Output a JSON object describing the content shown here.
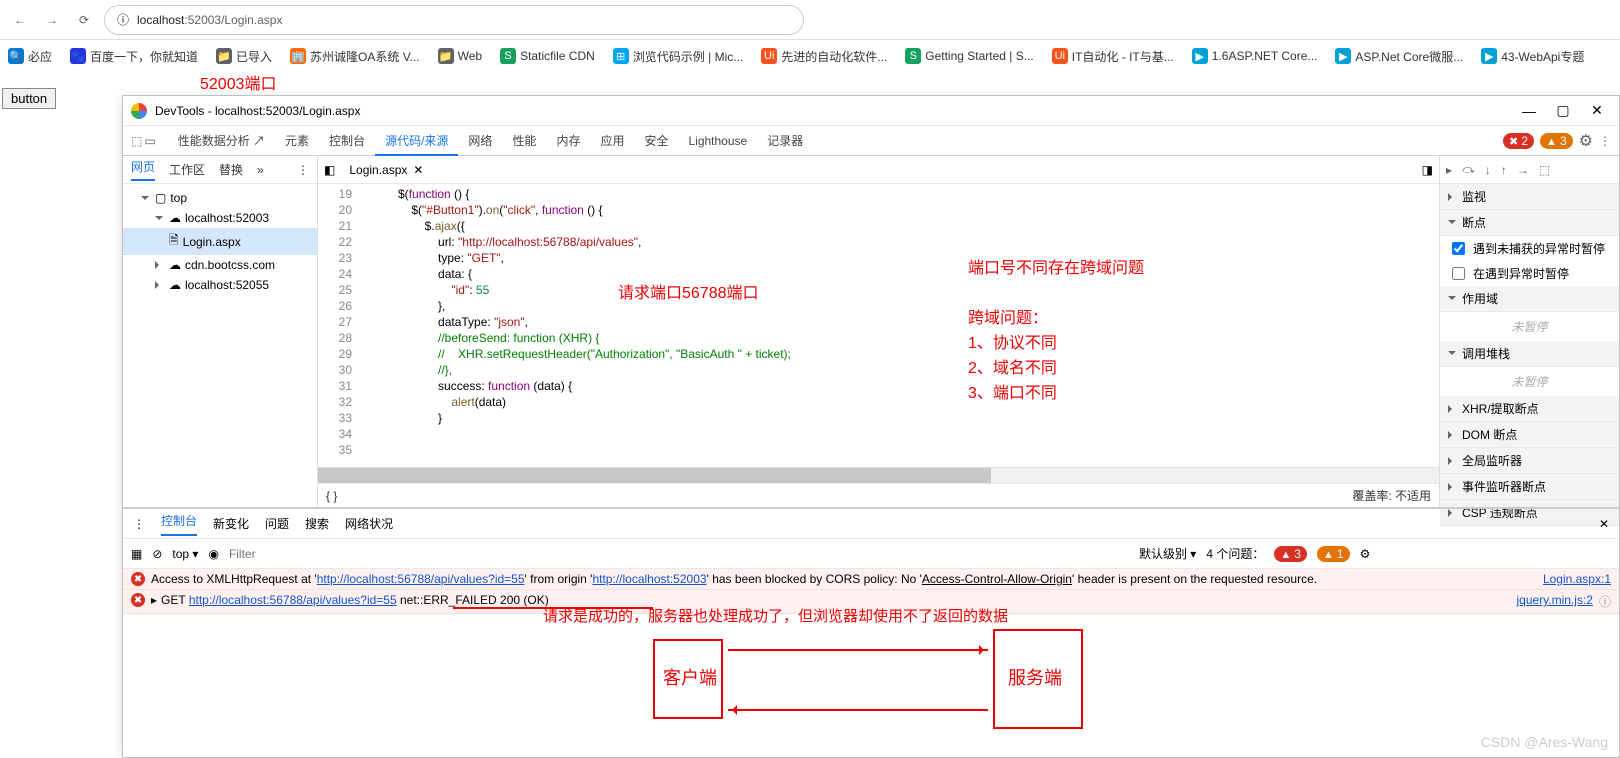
{
  "browser": {
    "url_host": "localhost",
    "url_port": ":52003",
    "url_path": "/Login.aspx",
    "info_icon": "ⓘ"
  },
  "bookmarks": [
    {
      "icon": "🔍",
      "label": "必应",
      "color": "#0078d4"
    },
    {
      "icon": "🐾",
      "label": "百度一下，你就知道",
      "color": "#2932e1"
    },
    {
      "icon": "📁",
      "label": "已导入",
      "color": "#5f6368"
    },
    {
      "icon": "🏢",
      "label": "苏州诚隆OA系统 V...",
      "color": "#ff6a00"
    },
    {
      "icon": "📁",
      "label": "Web",
      "color": "#5f6368"
    },
    {
      "icon": "S",
      "label": "Staticfile CDN",
      "color": "#17a05e"
    },
    {
      "icon": "⊞",
      "label": "浏览代码示例 | Mic...",
      "color": "#00a4ef"
    },
    {
      "icon": "Ui",
      "label": "先进的自动化软件...",
      "color": "#fa541c"
    },
    {
      "icon": "S",
      "label": "Getting Started | S...",
      "color": "#17a05e"
    },
    {
      "icon": "Ui",
      "label": "IT自动化 - IT与基...",
      "color": "#fa541c"
    },
    {
      "icon": "▶",
      "label": "1.6ASP.NET Core...",
      "color": "#00a1d6"
    },
    {
      "icon": "▶",
      "label": "ASP.Net Core微服...",
      "color": "#00a1d6"
    },
    {
      "icon": "▶",
      "label": "43-WebApi专题",
      "color": "#00a1d6"
    }
  ],
  "annotations": {
    "port": "52003端口",
    "request_port": "请求端口56788端口",
    "cors_title": "端口号不同存在跨域问题",
    "cors_header": "跨域问题：",
    "cors_1": "1、协议不同",
    "cors_2": "2、域名不同",
    "cors_3": "3、端口不同",
    "success_note": "请求是成功的，服务器也处理成功了，但浏览器却使用不了返回的数据",
    "client": "客户端",
    "server": "服务端"
  },
  "button_label": "button",
  "devtools": {
    "title": "DevTools - localhost:52003/Login.aspx",
    "tabs": [
      "性能数据分析 ↗",
      "元素",
      "控制台",
      "源代码/来源",
      "网络",
      "性能",
      "内存",
      "应用",
      "安全",
      "Lighthouse",
      "记录器"
    ],
    "active_tab": "源代码/来源",
    "errors": "2",
    "warnings": "3",
    "src_tabs": [
      "网页",
      "工作区",
      "替换",
      "»"
    ],
    "src_active": "网页",
    "tree": {
      "top": "top",
      "h1": "localhost:52003",
      "file": "Login.aspx",
      "h2": "cdn.bootcss.com",
      "h3": "localhost:52055"
    },
    "open_file": "Login.aspx",
    "coverage": "覆盖率: 不适用",
    "lines": [
      "19",
      "20",
      "21",
      "22",
      "23",
      "24",
      "25",
      "26",
      "27",
      "28",
      "29",
      "30",
      "31",
      "32",
      "33",
      "34",
      "35"
    ],
    "debug": {
      "watch": "监视",
      "breakpoints": "断点",
      "bp1": "遇到未捕获的异常时暂停",
      "bp2": "在遇到异常时暂停",
      "scope": "作用域",
      "not_paused": "未暂停",
      "callstack": "调用堆栈",
      "xhr": "XHR/提取断点",
      "dom": "DOM 断点",
      "global": "全局监听器",
      "event": "事件监听器断点",
      "csp": "CSP 违规断点"
    },
    "console": {
      "tabs": [
        "控制台",
        "新变化",
        "问题",
        "搜索",
        "网络状况"
      ],
      "active": "控制台",
      "context": "top",
      "filter_ph": "Filter",
      "level": "默认级别",
      "issues": "4 个问题：",
      "issue_err": "3",
      "issue_warn": "1",
      "msg1_pre": "Access to XMLHttpRequest at '",
      "msg1_url1": "http://localhost:56788/api/values?id=55",
      "msg1_mid": "' from origin '",
      "msg1_url2": "http://localhost:52003",
      "msg1_post": "' has been blocked by CORS policy: No '",
      "msg1_hdr": "Access-Control-Allow-Origin",
      "msg1_end": "' header is present on the requested resource.",
      "msg1_src": "Login.aspx:1",
      "msg2_pre": "GET ",
      "msg2_url": "http://localhost:56788/api/values?id=55",
      "msg2_post": " net::ERR_FAILED 200 (OK)",
      "msg2_src": "jquery.min.js:2"
    }
  },
  "watermark": "CSDN @Ares-Wang"
}
